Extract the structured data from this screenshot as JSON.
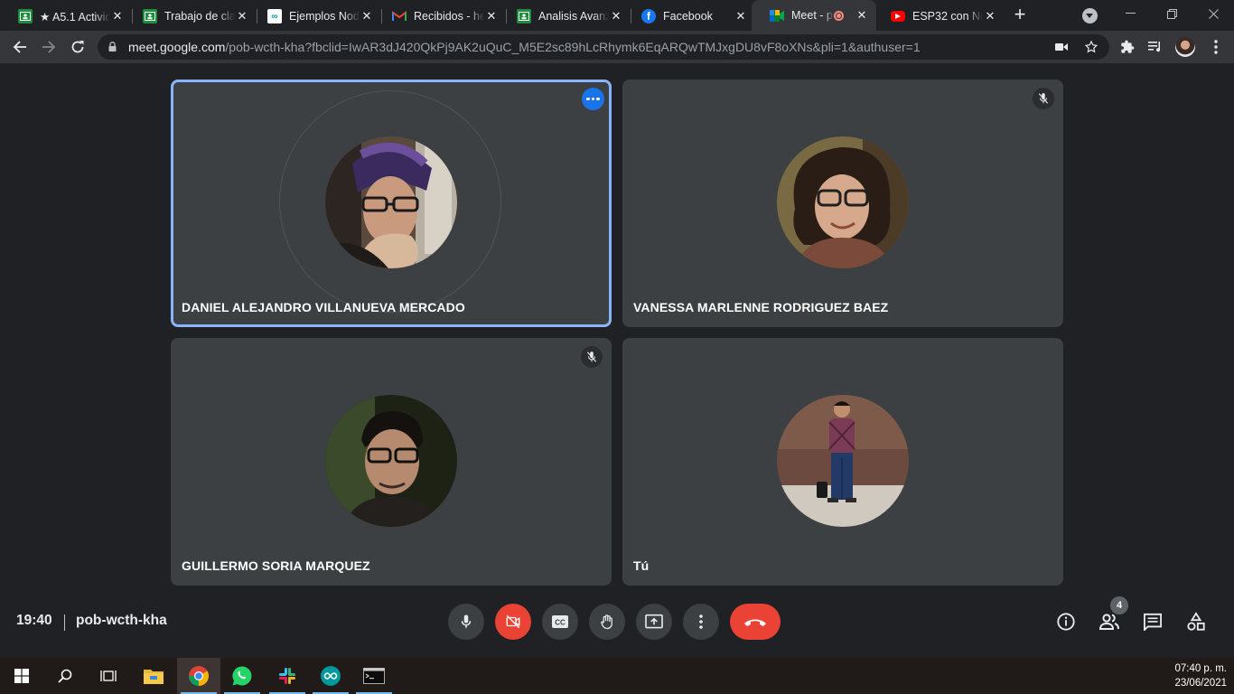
{
  "browser": {
    "tabs": [
      {
        "title": "★ A5.1 Activid",
        "favicon": "classroom-icon",
        "color": "#1e8e3e"
      },
      {
        "title": "Trabajo de cla",
        "favicon": "classroom-icon",
        "color": "#1e8e3e"
      },
      {
        "title": "Ejemplos Nod",
        "favicon": "arduino-icon",
        "color": "#ffffff"
      },
      {
        "title": "Recibidos - he",
        "favicon": "gmail-icon",
        "color": "#ffffff"
      },
      {
        "title": "Analisis Avanz",
        "favicon": "classroom-icon",
        "color": "#1e8e3e"
      },
      {
        "title": "Facebook",
        "favicon": "facebook-icon",
        "color": "#1877f2"
      },
      {
        "title": "Meet - po",
        "favicon": "meet-icon",
        "color": "#00832d",
        "active": true,
        "recording": true
      },
      {
        "title": "ESP32 con No",
        "favicon": "youtube-icon",
        "color": "#ff0000"
      }
    ],
    "url_host": "meet.google.com",
    "url_path": "/pob-wcth-kha?fbclid=IwAR3dJ420QkPj9AK2uQuC_M5E2sc89hLcRhymk6EqARQwTMJxgDU8vF8oXNs&pli=1&authuser=1"
  },
  "meet": {
    "participants": [
      {
        "name": "DANIEL ALEJANDRO VILLANUEVA MERCADO",
        "speaking": true,
        "muted": false
      },
      {
        "name": "VANESSA MARLENNE RODRIGUEZ BAEZ",
        "speaking": false,
        "muted": true
      },
      {
        "name": "GUILLERMO SORIA MARQUEZ",
        "speaking": false,
        "muted": true
      },
      {
        "name": "Tú",
        "speaking": false,
        "muted": false
      }
    ],
    "time": "19:40",
    "meeting_code": "pob-wcth-kha",
    "people_count": "4",
    "accent_color": "#8ab4f8",
    "hangup_color": "#ea4335"
  },
  "taskbar": {
    "apps": [
      "windows-start-icon",
      "search-icon",
      "task-view-icon",
      "file-explorer-icon",
      "chrome-icon",
      "whatsapp-icon",
      "slack-icon",
      "arduino-icon",
      "terminal-icon"
    ],
    "clock_time": "07:40 p. m.",
    "clock_date": "23/06/2021"
  }
}
